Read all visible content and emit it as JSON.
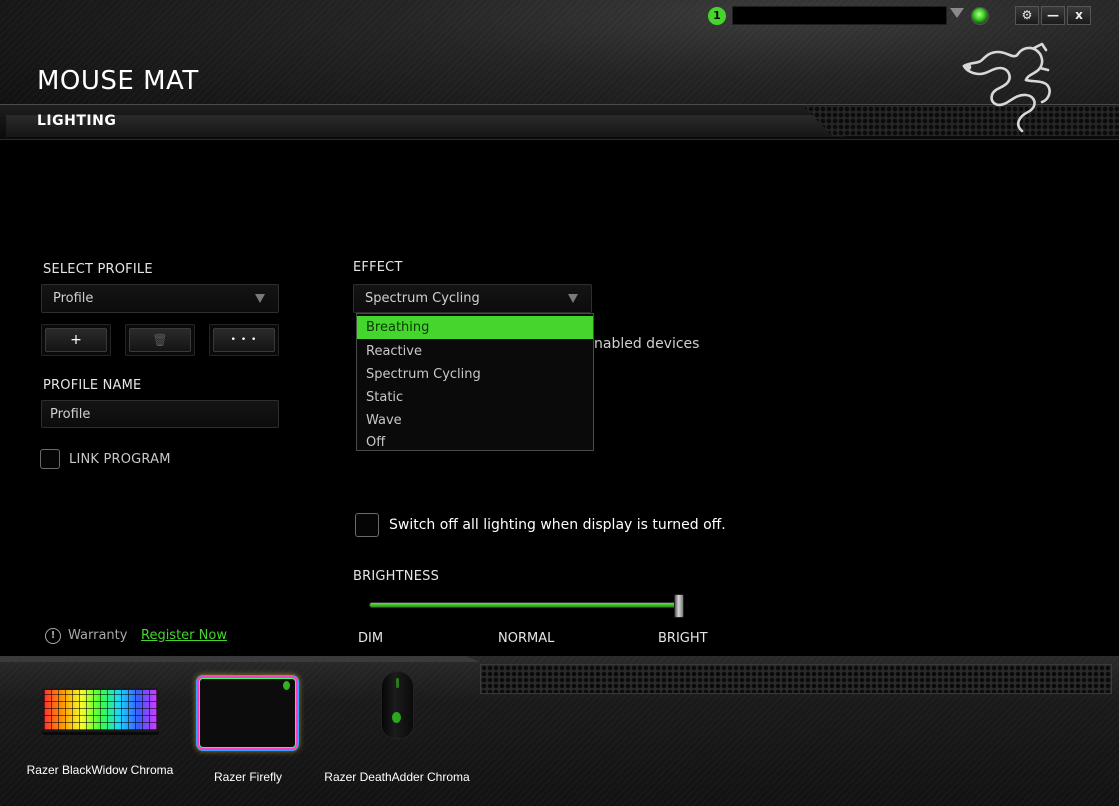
{
  "header": {
    "page_title": "MOUSE MAT",
    "section_title": "LIGHTING",
    "notification_count": "1",
    "controls": {
      "settings": "⚙",
      "minimize": "—",
      "close": "x"
    },
    "logo": "razer-logo"
  },
  "profile": {
    "select_label": "SELECT PROFILE",
    "selected": "Profile",
    "buttons": {
      "add": "+",
      "delete": "🗑",
      "more": "• • •"
    },
    "name_label": "PROFILE NAME",
    "name_value": "Profile",
    "link_program_label": "LINK PROGRAM",
    "link_program_checked": false
  },
  "effect": {
    "label": "EFFECT",
    "selected": "Spectrum Cycling",
    "options": [
      "Breathing",
      "Reactive",
      "Spectrum Cycling",
      "Static",
      "Wave",
      "Off"
    ],
    "highlighted_option": "Breathing",
    "partially_hidden_text": "nabled devices"
  },
  "display_off": {
    "label": "Switch off all lighting when display is turned off.",
    "checked": false
  },
  "brightness": {
    "label": "BRIGHTNESS",
    "value_fraction": 1.0,
    "ticks": [
      "DIM",
      "NORMAL",
      "BRIGHT"
    ]
  },
  "warranty": {
    "label": "Warranty",
    "link": "Register Now"
  },
  "devices": [
    {
      "name": "Razer BlackWidow Chroma",
      "icon": "keyboard-icon"
    },
    {
      "name": "Razer Firefly",
      "icon": "mousemat-icon"
    },
    {
      "name": "Razer DeathAdder Chroma",
      "icon": "mouse-icon"
    }
  ],
  "colors": {
    "accent": "#44d62c",
    "background": "#000000",
    "text": "#e6e6e6"
  }
}
